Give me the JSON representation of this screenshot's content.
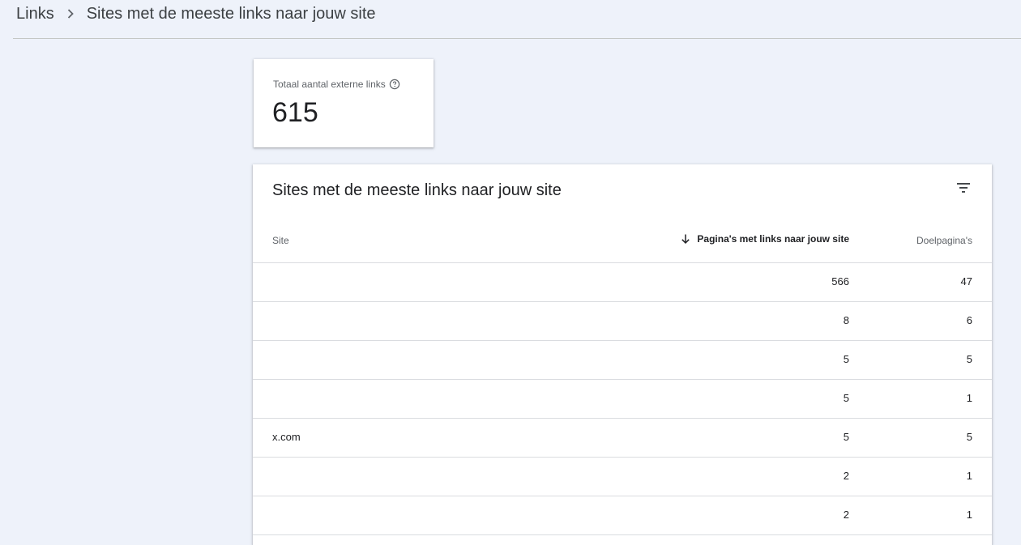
{
  "breadcrumb": {
    "parent": "Links",
    "current": "Sites met de meeste links naar jouw site",
    "separator_icon": "chevron-right-icon"
  },
  "total_card": {
    "label": "Totaal aantal externe links",
    "value": "615",
    "help_icon": "help-circle-icon"
  },
  "table": {
    "title": "Sites met de meeste links naar jouw site",
    "filter_icon": "filter-icon",
    "columns": {
      "site": "Site",
      "pages": "Pagina's met links naar jouw site",
      "targets": "Doelpagina's",
      "sort_icon": "arrow-down-icon"
    },
    "rows": [
      {
        "site": "",
        "pages": "566",
        "targets": "47"
      },
      {
        "site": "",
        "pages": "8",
        "targets": "6"
      },
      {
        "site": "",
        "pages": "5",
        "targets": "5"
      },
      {
        "site": "",
        "pages": "5",
        "targets": "1"
      },
      {
        "site": "x.com",
        "pages": "5",
        "targets": "5"
      },
      {
        "site": "",
        "pages": "2",
        "targets": "1"
      },
      {
        "site": "",
        "pages": "2",
        "targets": "1"
      }
    ]
  },
  "colors": {
    "background": "#eef2fa",
    "card": "#ffffff",
    "divider": "#dadce0",
    "text_primary": "#202124",
    "text_secondary": "#5f6368"
  }
}
